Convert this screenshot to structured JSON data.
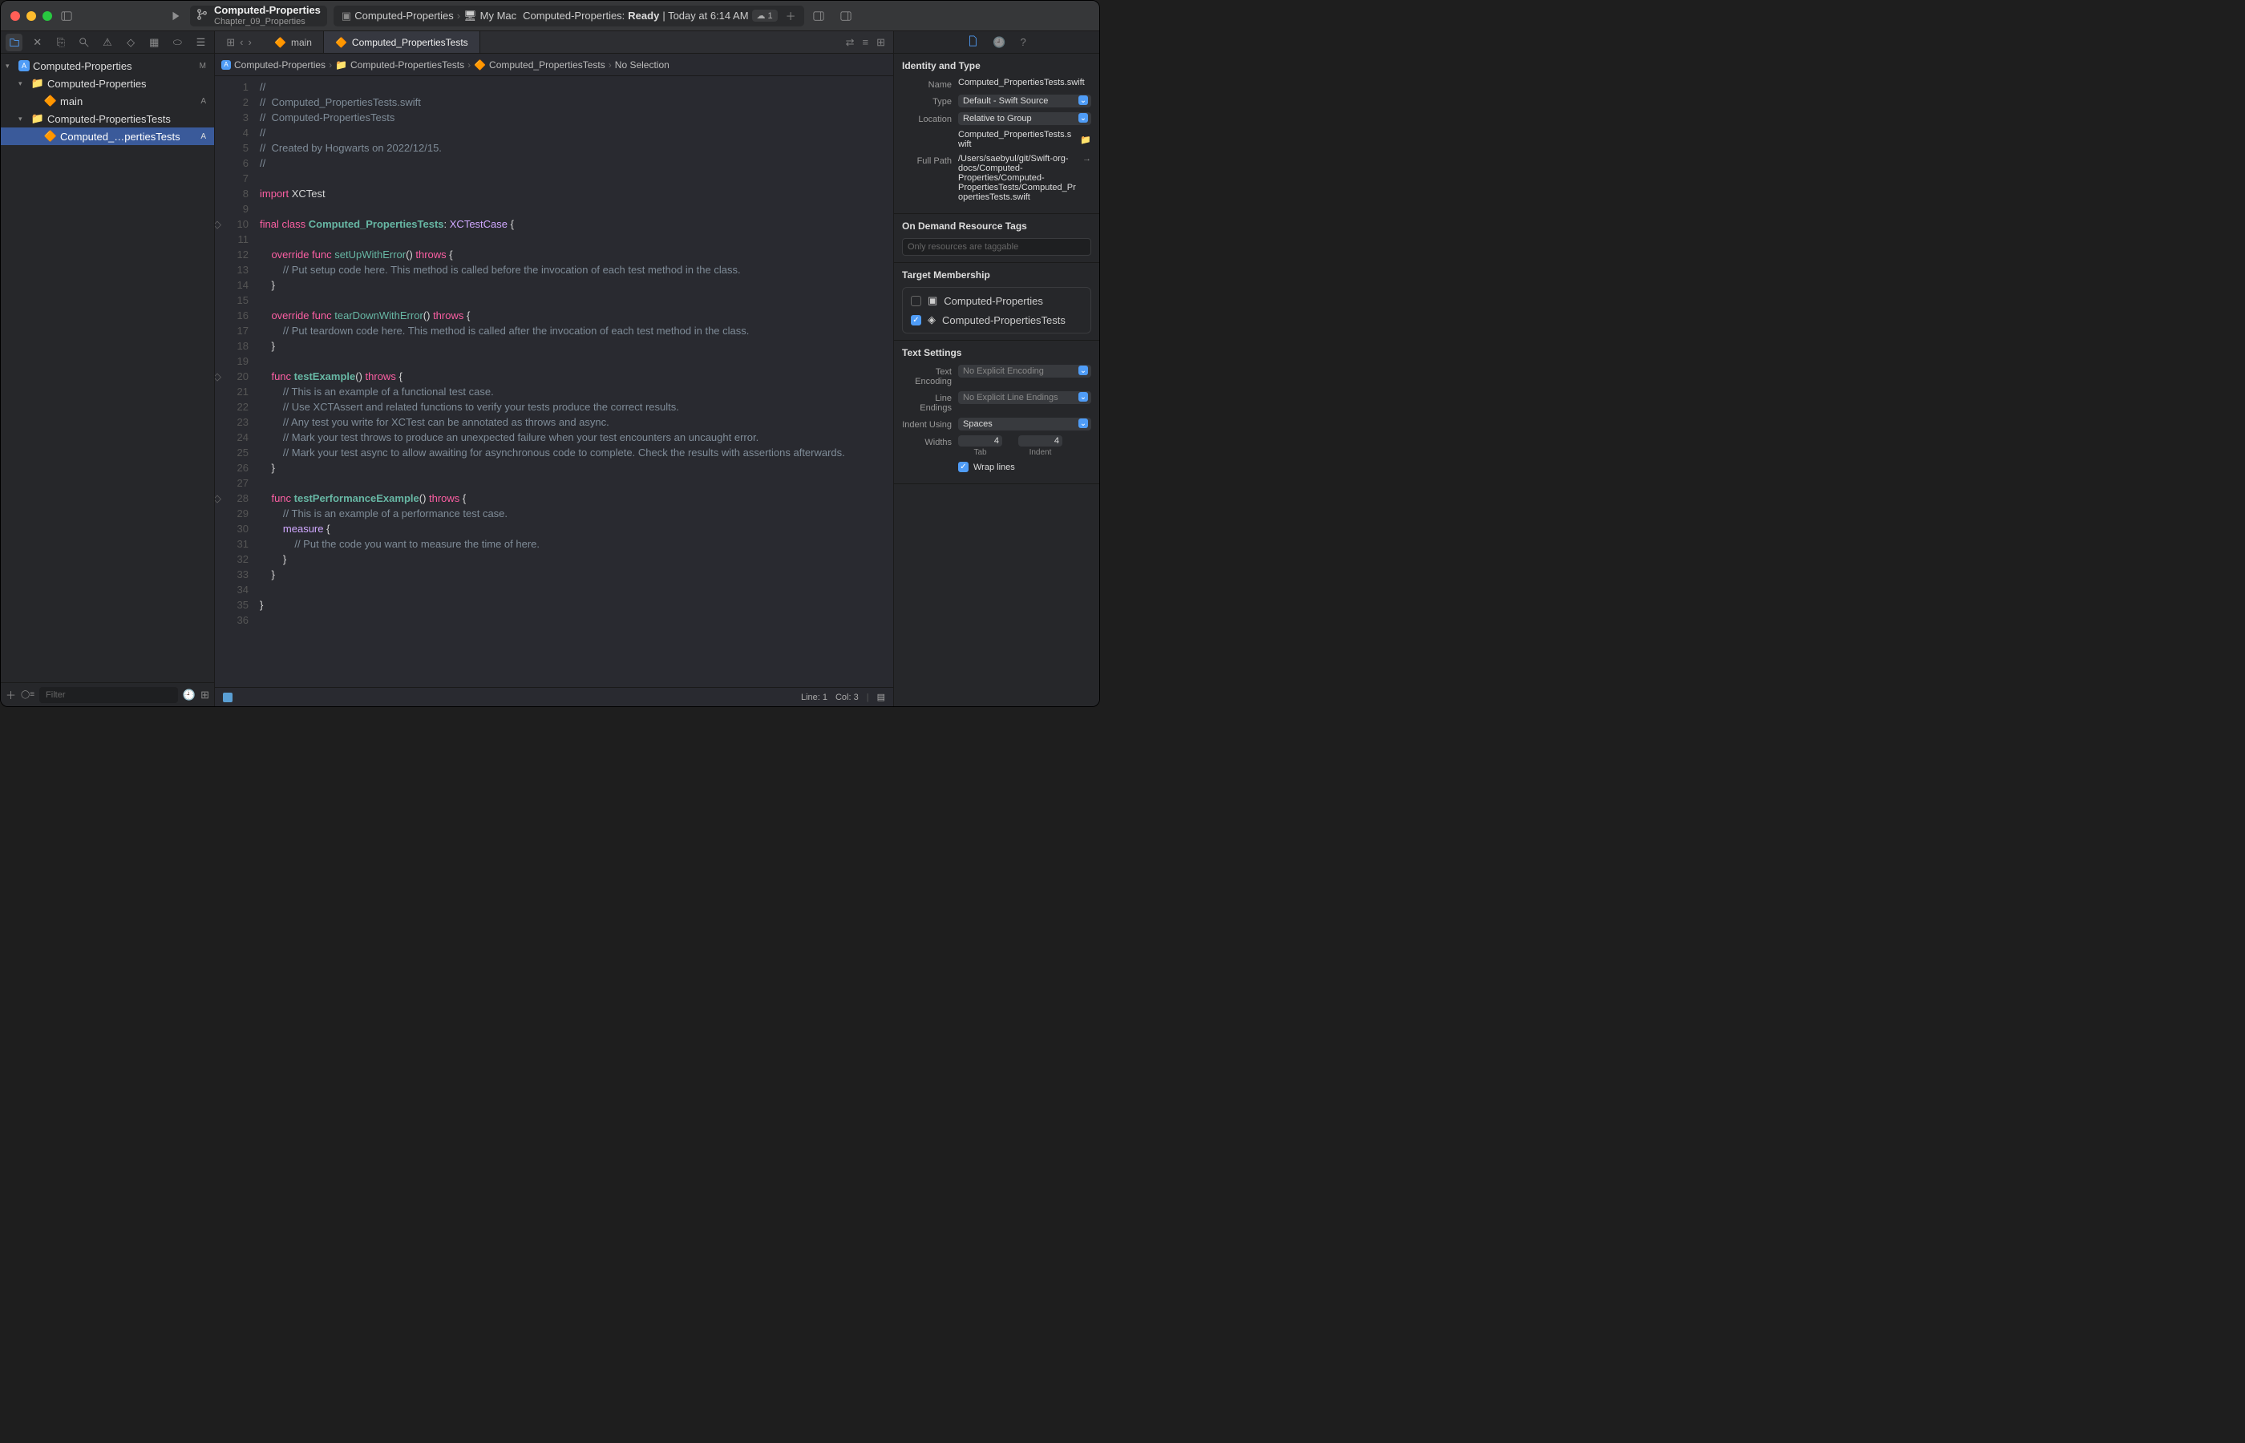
{
  "titlebar": {
    "project_name": "Computed-Properties",
    "project_sub": "Chapter_09_Properties",
    "scheme": "Computed-Properties",
    "destination": "My Mac",
    "status_prefix": "Computed-Properties:",
    "status_ready": "Ready",
    "status_time": "| Today at 6:14 AM",
    "cloud_count": "1"
  },
  "navigator": {
    "items": [
      {
        "label": "Computed-Properties",
        "level": 0,
        "icon": "project",
        "badge": "M",
        "disclosure": "open"
      },
      {
        "label": "Computed-Properties",
        "level": 1,
        "icon": "folder",
        "badge": "",
        "disclosure": "open"
      },
      {
        "label": "main",
        "level": 2,
        "icon": "swift",
        "badge": "A",
        "disclosure": ""
      },
      {
        "label": "Computed-PropertiesTests",
        "level": 1,
        "icon": "folder",
        "badge": "",
        "disclosure": "open"
      },
      {
        "label": "Computed_…pertiesTests",
        "level": 2,
        "icon": "swift",
        "badge": "A",
        "disclosure": "",
        "selected": true
      }
    ],
    "filter_placeholder": "Filter"
  },
  "tabs": [
    {
      "label": "main",
      "active": false
    },
    {
      "label": "Computed_PropertiesTests",
      "active": true
    }
  ],
  "breadcrumb": [
    {
      "label": "Computed-Properties",
      "icon": "project"
    },
    {
      "label": "Computed-PropertiesTests",
      "icon": "folder"
    },
    {
      "label": "Computed_PropertiesTests",
      "icon": "swift"
    },
    {
      "label": "No Selection",
      "icon": ""
    }
  ],
  "code": {
    "lines": [
      {
        "n": 1,
        "segs": [
          [
            "//",
            "comment"
          ]
        ]
      },
      {
        "n": 2,
        "segs": [
          [
            "//  Computed_PropertiesTests.swift",
            "comment"
          ]
        ]
      },
      {
        "n": 3,
        "segs": [
          [
            "//  Computed-PropertiesTests",
            "comment"
          ]
        ]
      },
      {
        "n": 4,
        "segs": [
          [
            "//",
            "comment"
          ]
        ]
      },
      {
        "n": 5,
        "segs": [
          [
            "//  Created by Hogwarts on 2022/12/15.",
            "comment"
          ]
        ]
      },
      {
        "n": 6,
        "segs": [
          [
            "//",
            "comment"
          ]
        ]
      },
      {
        "n": 7,
        "segs": []
      },
      {
        "n": 8,
        "segs": [
          [
            "import",
            "keyword"
          ],
          [
            " XCTest",
            "plain"
          ]
        ]
      },
      {
        "n": 9,
        "segs": []
      },
      {
        "n": 10,
        "segs": [
          [
            "final",
            "keyword"
          ],
          [
            " ",
            "plain"
          ],
          [
            "class",
            "keyword"
          ],
          [
            " ",
            "plain"
          ],
          [
            "Computed_PropertiesTests",
            "func"
          ],
          [
            ": ",
            "plain"
          ],
          [
            "XCTestCase",
            "type"
          ],
          [
            " {",
            "plain"
          ]
        ],
        "diamond": true,
        "bold_func": true
      },
      {
        "n": 11,
        "segs": []
      },
      {
        "n": 12,
        "segs": [
          [
            "    ",
            "plain"
          ],
          [
            "override",
            "keyword"
          ],
          [
            " ",
            "plain"
          ],
          [
            "func",
            "keyword"
          ],
          [
            " ",
            "plain"
          ],
          [
            "setUpWithError",
            "func"
          ],
          [
            "() ",
            "plain"
          ],
          [
            "throws",
            "keyword"
          ],
          [
            " {",
            "plain"
          ]
        ]
      },
      {
        "n": 13,
        "segs": [
          [
            "        ",
            "plain"
          ],
          [
            "// Put setup code here. This method is called before the invocation of each test method in the class.",
            "comment"
          ]
        ]
      },
      {
        "n": 14,
        "segs": [
          [
            "    }",
            "plain"
          ]
        ]
      },
      {
        "n": 15,
        "segs": []
      },
      {
        "n": 16,
        "segs": [
          [
            "    ",
            "plain"
          ],
          [
            "override",
            "keyword"
          ],
          [
            " ",
            "plain"
          ],
          [
            "func",
            "keyword"
          ],
          [
            " ",
            "plain"
          ],
          [
            "tearDownWithError",
            "func"
          ],
          [
            "() ",
            "plain"
          ],
          [
            "throws",
            "keyword"
          ],
          [
            " {",
            "plain"
          ]
        ]
      },
      {
        "n": 17,
        "segs": [
          [
            "        ",
            "plain"
          ],
          [
            "// Put teardown code here. This method is called after the invocation of each test method in the class.",
            "comment"
          ]
        ]
      },
      {
        "n": 18,
        "segs": [
          [
            "    }",
            "plain"
          ]
        ]
      },
      {
        "n": 19,
        "segs": []
      },
      {
        "n": 20,
        "segs": [
          [
            "    ",
            "plain"
          ],
          [
            "func",
            "keyword"
          ],
          [
            " ",
            "plain"
          ],
          [
            "testExample",
            "func"
          ],
          [
            "() ",
            "plain"
          ],
          [
            "throws",
            "keyword"
          ],
          [
            " {",
            "plain"
          ]
        ],
        "diamond": true,
        "bold_func": true
      },
      {
        "n": 21,
        "segs": [
          [
            "        ",
            "plain"
          ],
          [
            "// This is an example of a functional test case.",
            "comment"
          ]
        ]
      },
      {
        "n": 22,
        "segs": [
          [
            "        ",
            "plain"
          ],
          [
            "// Use XCTAssert and related functions to verify your tests produce the correct results.",
            "comment"
          ]
        ]
      },
      {
        "n": 23,
        "segs": [
          [
            "        ",
            "plain"
          ],
          [
            "// Any test you write for XCTest can be annotated as throws and async.",
            "comment"
          ]
        ]
      },
      {
        "n": 24,
        "segs": [
          [
            "        ",
            "plain"
          ],
          [
            "// Mark your test throws to produce an unexpected failure when your test encounters an uncaught error.",
            "comment"
          ]
        ]
      },
      {
        "n": 25,
        "segs": [
          [
            "        ",
            "plain"
          ],
          [
            "// Mark your test async to allow awaiting for asynchronous code to complete. Check the results with assertions afterwards.",
            "comment"
          ]
        ]
      },
      {
        "n": 26,
        "segs": [
          [
            "    }",
            "plain"
          ]
        ]
      },
      {
        "n": 27,
        "segs": []
      },
      {
        "n": 28,
        "segs": [
          [
            "    ",
            "plain"
          ],
          [
            "func",
            "keyword"
          ],
          [
            " ",
            "plain"
          ],
          [
            "testPerformanceExample",
            "func"
          ],
          [
            "() ",
            "plain"
          ],
          [
            "throws",
            "keyword"
          ],
          [
            " {",
            "plain"
          ]
        ],
        "diamond": true,
        "bold_func": true
      },
      {
        "n": 29,
        "segs": [
          [
            "        ",
            "plain"
          ],
          [
            "// This is an example of a performance test case.",
            "comment"
          ]
        ]
      },
      {
        "n": 30,
        "segs": [
          [
            "        ",
            "plain"
          ],
          [
            "measure",
            "type"
          ],
          [
            " {",
            "plain"
          ]
        ]
      },
      {
        "n": 31,
        "segs": [
          [
            "            ",
            "plain"
          ],
          [
            "// Put the code you want to measure the time of here.",
            "comment"
          ]
        ]
      },
      {
        "n": 32,
        "segs": [
          [
            "        }",
            "plain"
          ]
        ]
      },
      {
        "n": 33,
        "segs": [
          [
            "    }",
            "plain"
          ]
        ]
      },
      {
        "n": 34,
        "segs": []
      },
      {
        "n": 35,
        "segs": [
          [
            "}",
            "plain"
          ]
        ]
      },
      {
        "n": 36,
        "segs": []
      }
    ]
  },
  "status_bar": {
    "line": "Line: 1",
    "col": "Col: 3"
  },
  "inspector": {
    "identity_title": "Identity and Type",
    "name_label": "Name",
    "name_value": "Computed_PropertiesTests.swift",
    "type_label": "Type",
    "type_value": "Default - Swift Source",
    "location_label": "Location",
    "location_value": "Relative to Group",
    "location_path": "Computed_PropertiesTests.swift",
    "fullpath_label": "Full Path",
    "fullpath_value": "/Users/saebyul/git/Swift-org-docs/Computed-Properties/Computed-PropertiesTests/Computed_PropertiesTests.swift",
    "odr_title": "On Demand Resource Tags",
    "odr_placeholder": "Only resources are taggable",
    "target_title": "Target Membership",
    "targets": [
      {
        "label": "Computed-Properties",
        "checked": false,
        "icon": "cmd"
      },
      {
        "label": "Computed-PropertiesTests",
        "checked": true,
        "icon": "test"
      }
    ],
    "text_title": "Text Settings",
    "encoding_label": "Text Encoding",
    "encoding_value": "No Explicit Encoding",
    "endings_label": "Line Endings",
    "endings_value": "No Explicit Line Endings",
    "indent_label": "Indent Using",
    "indent_value": "Spaces",
    "widths_label": "Widths",
    "tab_width": "4",
    "indent_width": "4",
    "tab_sublabel": "Tab",
    "indent_sublabel": "Indent",
    "wrap_label": "Wrap lines"
  }
}
